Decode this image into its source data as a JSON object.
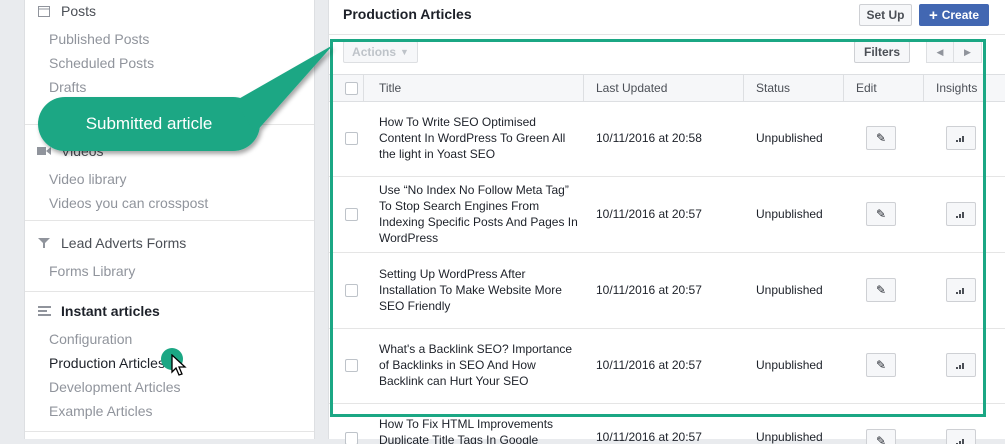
{
  "sidebar": {
    "posts": {
      "label": "Posts",
      "items": [
        "Published Posts",
        "Scheduled Posts",
        "Drafts"
      ]
    },
    "videos": {
      "label": "Videos",
      "items": [
        "Video library",
        "Videos you can crosspost"
      ]
    },
    "lead_forms": {
      "label": "Lead Adverts Forms",
      "items": [
        "Forms Library"
      ]
    },
    "instant": {
      "label": "Instant articles",
      "items": [
        "Configuration",
        "Production Articles",
        "Development Articles",
        "Example Articles"
      ]
    }
  },
  "main": {
    "title": "Production Articles",
    "setup_label": "Set Up",
    "create_label": "Create",
    "actions_label": "Actions",
    "filters_label": "Filters",
    "columns": {
      "title": "Title",
      "last_updated": "Last Updated",
      "status": "Status",
      "edit": "Edit",
      "insights": "Insights"
    },
    "rows": [
      {
        "title": "How To Write SEO Optimised Content In WordPress To Green All the light in Yoast SEO",
        "date": "10/11/2016 at 20:58",
        "status": "Unpublished"
      },
      {
        "title": "Use “No Index No Follow Meta Tag” To Stop Search Engines From Indexing Specific Posts And Pages In WordPress",
        "date": "10/11/2016 at 20:57",
        "status": "Unpublished"
      },
      {
        "title": "Setting Up WordPress After Installation To Make Website More SEO Friendly",
        "date": "10/11/2016 at 20:57",
        "status": "Unpublished"
      },
      {
        "title": "What's a Backlink SEO? Importance of Backlinks in SEO And How Backlink can Hurt Your SEO",
        "date": "10/11/2016 at 20:57",
        "status": "Unpublished"
      },
      {
        "title": "How To Fix HTML Improvements Duplicate Title Tags In Google",
        "date": "10/11/2016 at 20:57",
        "status": "Unpublished"
      }
    ]
  },
  "annotation": {
    "callout": "Submitted article",
    "accent": "#1ba784"
  },
  "colors": {
    "brand": "#4267b2",
    "accent": "#1ba784"
  }
}
